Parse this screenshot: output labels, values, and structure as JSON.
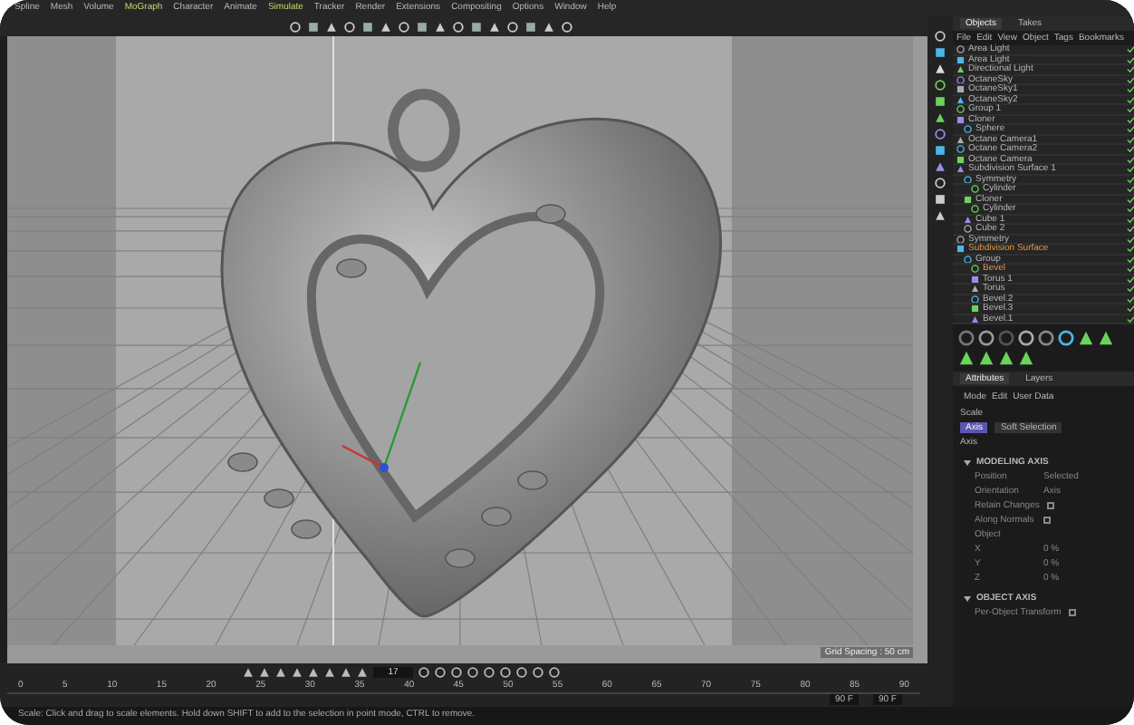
{
  "menu_bar": [
    {
      "label": "Spline",
      "highlighted": false
    },
    {
      "label": "Mesh",
      "highlighted": false
    },
    {
      "label": "Volume",
      "highlighted": false
    },
    {
      "label": "MoGraph",
      "highlighted": true
    },
    {
      "label": "Character",
      "highlighted": false
    },
    {
      "label": "Animate",
      "highlighted": false
    },
    {
      "label": "Simulate",
      "highlighted": true
    },
    {
      "label": "Tracker",
      "highlighted": false
    },
    {
      "label": "Render",
      "highlighted": false
    },
    {
      "label": "Extensions",
      "highlighted": false
    },
    {
      "label": "Compositing",
      "highlighted": false
    },
    {
      "label": "Options",
      "highlighted": false
    },
    {
      "label": "Window",
      "highlighted": false
    },
    {
      "label": "Help",
      "highlighted": false
    }
  ],
  "viewport": {
    "grid_label": "Grid Spacing : 50 cm"
  },
  "object_manager": {
    "tabs": [
      {
        "label": "Objects",
        "selected": true
      },
      {
        "label": "Takes",
        "selected": false
      }
    ],
    "menu": [
      "File",
      "Edit",
      "View",
      "Object",
      "Tags",
      "Bookmarks"
    ],
    "objects": [
      {
        "name": "Area Light",
        "highlighted": false
      },
      {
        "name": "Area Light",
        "highlighted": false
      },
      {
        "name": "Directional Light",
        "highlighted": false
      },
      {
        "name": "OctaneSky",
        "highlighted": false
      },
      {
        "name": "OctaneSky1",
        "highlighted": false
      },
      {
        "name": "OctaneSky2",
        "highlighted": false
      },
      {
        "name": "Group 1",
        "highlighted": false
      },
      {
        "name": "Cloner",
        "highlighted": false,
        "children": [
          {
            "name": "Sphere",
            "highlighted": false
          }
        ]
      },
      {
        "name": "Octane Camera1",
        "highlighted": false
      },
      {
        "name": "Octane Camera2",
        "highlighted": false
      },
      {
        "name": "Octane Camera",
        "highlighted": false
      },
      {
        "name": "Subdivision Surface 1",
        "highlighted": false,
        "children": [
          {
            "name": "Symmetry",
            "highlighted": false,
            "children": [
              {
                "name": "Cylinder",
                "highlighted": false
              }
            ]
          },
          {
            "name": "Cloner",
            "highlighted": false,
            "children": [
              {
                "name": "Cylinder",
                "highlighted": false
              }
            ]
          },
          {
            "name": "Cube 1",
            "highlighted": false
          },
          {
            "name": "Cube 2",
            "highlighted": false
          }
        ]
      },
      {
        "name": "Symmetry",
        "highlighted": false
      },
      {
        "name": "Subdivision Surface",
        "highlighted": true,
        "children": [
          {
            "name": "Group",
            "highlighted": false,
            "children": [
              {
                "name": "Bevel",
                "highlighted": true
              },
              {
                "name": "Torus 1",
                "highlighted": false
              },
              {
                "name": "Torus",
                "highlighted": false
              },
              {
                "name": "Bevel.2",
                "highlighted": false
              },
              {
                "name": "Bevel.3",
                "highlighted": false
              },
              {
                "name": "Bevel.1",
                "highlighted": false
              }
            ]
          }
        ]
      }
    ]
  },
  "attributes": {
    "tabs": [
      {
        "label": "Attributes",
        "selected": true
      },
      {
        "label": "Layers",
        "selected": false
      }
    ],
    "menu": [
      "Mode",
      "Edit",
      "User Data"
    ],
    "object_label": "Scale",
    "subtabs": [
      {
        "label": "Axis",
        "selected": true
      },
      {
        "label": "Soft Selection",
        "selected": false
      }
    ],
    "heading": "Axis",
    "sections": [
      {
        "title": "MODELING AXIS",
        "expanded": true,
        "fields": [
          {
            "kind": "text",
            "label": "Position",
            "value": "Selected"
          },
          {
            "kind": "text",
            "label": "Orientation",
            "value": "Axis"
          },
          {
            "kind": "checkbox",
            "label": "Retain Changes",
            "checked": false
          },
          {
            "kind": "checkbox",
            "label": "Along Normals",
            "checked": false
          },
          {
            "kind": "label",
            "label": "Object"
          },
          {
            "kind": "number",
            "label": "X",
            "value": "0 %"
          },
          {
            "kind": "number",
            "label": "Y",
            "value": "0 %"
          },
          {
            "kind": "number",
            "label": "Z",
            "value": "0 %"
          }
        ]
      },
      {
        "title": "OBJECT AXIS",
        "expanded": true,
        "fields": [
          {
            "kind": "checkbox",
            "label": "Per-Object Transform",
            "checked": false
          }
        ]
      }
    ]
  },
  "timeline": {
    "frame": "17",
    "ticks": [
      "0",
      "5",
      "10",
      "15",
      "20",
      "25",
      "30",
      "35",
      "40",
      "45",
      "50",
      "55",
      "60",
      "65",
      "70",
      "75",
      "80",
      "85",
      "90"
    ],
    "start_field": "90 F",
    "end_field": "90 F"
  },
  "status_bar": "Scale: Click and drag to scale elements. Hold down SHIFT to add to the selection in point mode, CTRL to remove."
}
